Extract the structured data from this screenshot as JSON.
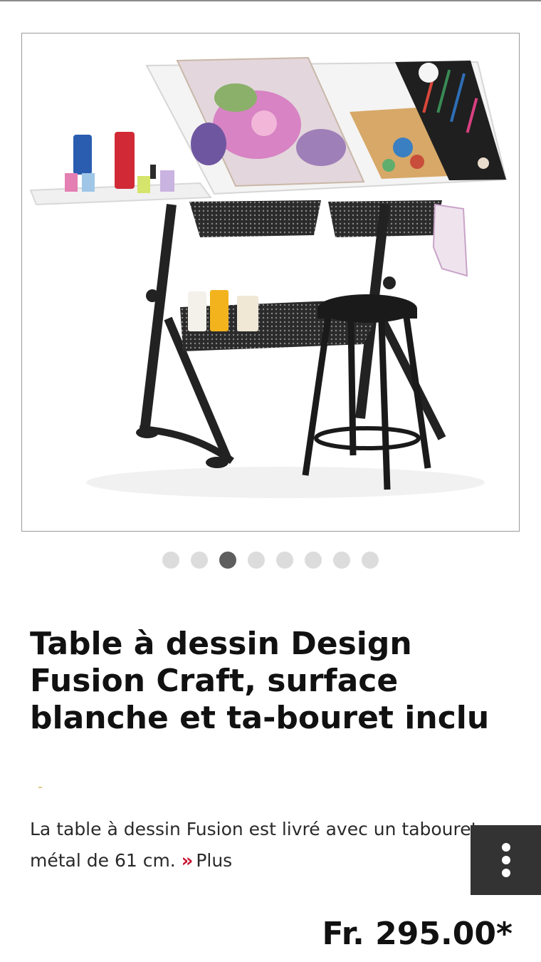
{
  "gallery": {
    "image_alt": "Table à dessin Design Fusion Craft",
    "slide_count": 8,
    "active_index": 2
  },
  "product": {
    "title": "Table à dessin Design Fusion Craft, surface blanche et ta-bouret inclu",
    "description": "La table à dessin Fusion est livré avec un tabouret en métal de 61 cm.",
    "more_label": "Plus",
    "price": "Fr. 295.00*"
  },
  "colors": {
    "accent": "#c8102e",
    "fab_bg": "#333333",
    "dot_active": "#5e5e5e",
    "dot_inactive": "#dcdcdc"
  }
}
